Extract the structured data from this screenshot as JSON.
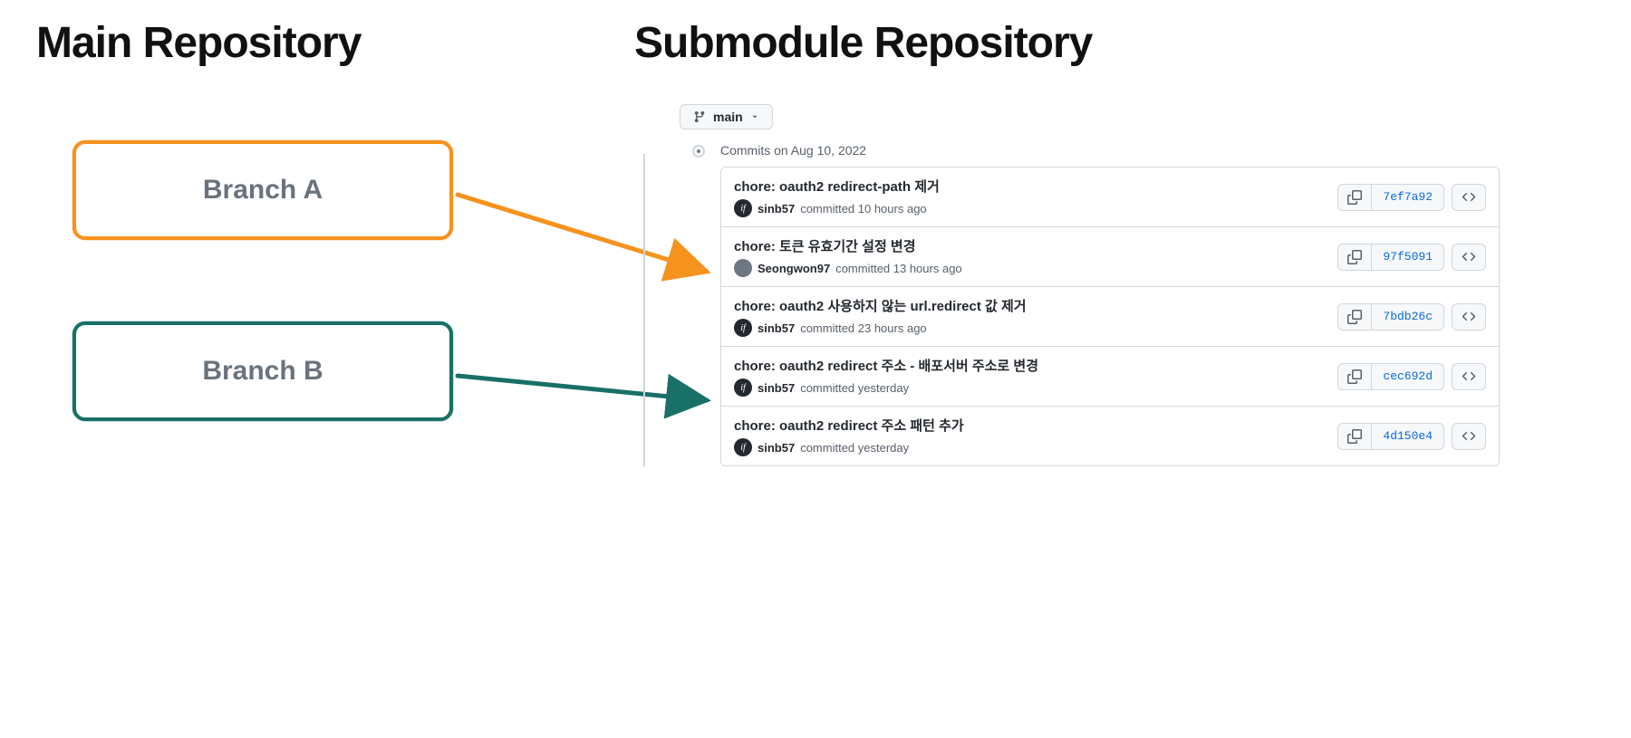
{
  "headings": {
    "main": "Main Repository",
    "submodule": "Submodule Repository"
  },
  "branches": {
    "a": "Branch A",
    "b": "Branch B"
  },
  "branch_selector": {
    "name": "main"
  },
  "timeline": {
    "group_label": "Commits on Aug 10, 2022"
  },
  "commits": [
    {
      "title": "chore: oauth2 redirect-path 제거",
      "author": "sinb57",
      "avatar": "if",
      "avatar_style": "dark",
      "time": "committed 10 hours ago",
      "sha": "7ef7a92"
    },
    {
      "title": "chore: 토큰 유효기간 설정 변경",
      "author": "Seongwon97",
      "avatar": "",
      "avatar_style": "grey",
      "time": "committed 13 hours ago",
      "sha": "97f5091"
    },
    {
      "title": "chore: oauth2 사용하지 않는 url.redirect 값 제거",
      "author": "sinb57",
      "avatar": "if",
      "avatar_style": "dark",
      "time": "committed 23 hours ago",
      "sha": "7bdb26c"
    },
    {
      "title": "chore: oauth2 redirect 주소 - 배포서버 주소로 변경",
      "author": "sinb57",
      "avatar": "if",
      "avatar_style": "dark",
      "time": "committed yesterday",
      "sha": "cec692d"
    },
    {
      "title": "chore: oauth2 redirect 주소 패턴 추가",
      "author": "sinb57",
      "avatar": "if",
      "avatar_style": "dark",
      "time": "committed yesterday",
      "sha": "4d150e4"
    }
  ],
  "arrows": {
    "a_color": "#f6921e",
    "b_color": "#187067"
  }
}
